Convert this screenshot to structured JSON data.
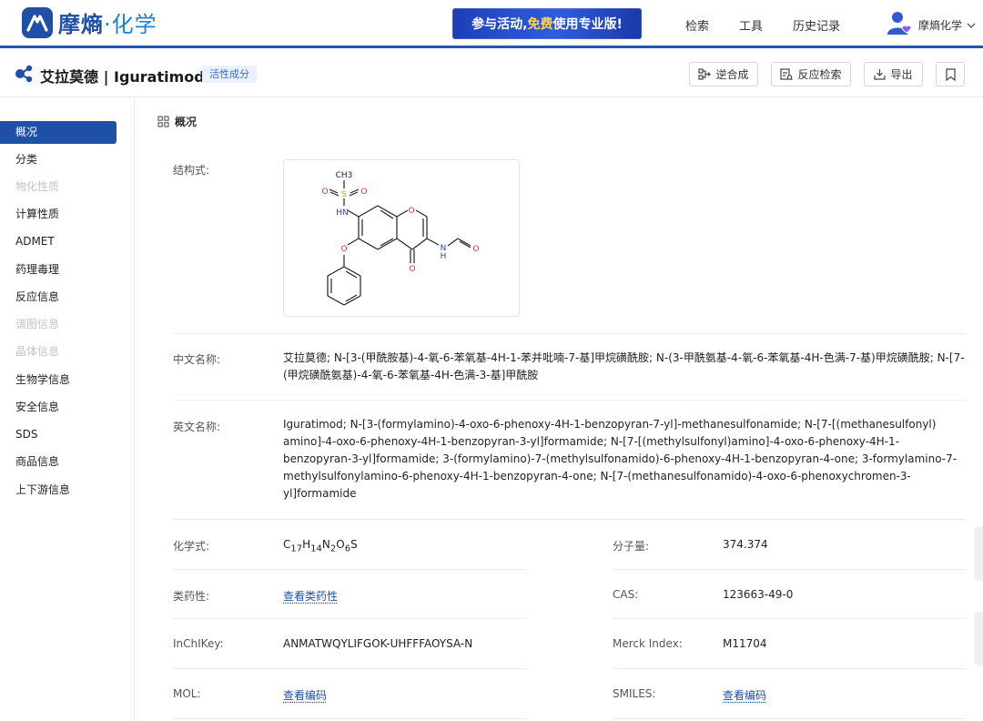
{
  "brand": {
    "name_main": "摩熵",
    "name_dot": "·",
    "name_accent": "化学"
  },
  "promo": {
    "pre": "参与活动,",
    "highlight": "免费",
    "post": "使用专业版!"
  },
  "nav": {
    "search": "检索",
    "tools": "工具",
    "history": "历史记录"
  },
  "user": {
    "name": "摩熵化学"
  },
  "compound": {
    "title": "艾拉莫德 | Iguratimod",
    "tag": "活性成分"
  },
  "toolbar": {
    "retro": "逆合成",
    "reaction_search": "反应检索",
    "export": "导出"
  },
  "sidebar": {
    "items": [
      {
        "label": "概况",
        "state": "active"
      },
      {
        "label": "分类",
        "state": "normal"
      },
      {
        "label": "物化性质",
        "state": "disabled"
      },
      {
        "label": "计算性质",
        "state": "normal"
      },
      {
        "label": "ADMET",
        "state": "normal"
      },
      {
        "label": "药理毒理",
        "state": "normal"
      },
      {
        "label": "反应信息",
        "state": "normal"
      },
      {
        "label": "谱图信息",
        "state": "disabled"
      },
      {
        "label": "晶体信息",
        "state": "disabled"
      },
      {
        "label": "生物学信息",
        "state": "normal"
      },
      {
        "label": "安全信息",
        "state": "normal"
      },
      {
        "label": "SDS",
        "state": "normal"
      },
      {
        "label": "商品信息",
        "state": "normal"
      },
      {
        "label": "上下游信息",
        "state": "normal"
      }
    ]
  },
  "overview": {
    "heading": "概况",
    "structure_label": "结构式:",
    "structure_atoms": {
      "ch3": "CH3",
      "s": "S",
      "o1": "O",
      "o2": "O",
      "nh1": "HN",
      "o_ring": "O",
      "o_ether": "O",
      "o_keto": "O",
      "nh2": "H",
      "n2": "N",
      "o_ald": "O"
    },
    "cn_name_label": "中文名称:",
    "cn_name": "艾拉莫德; N-[3-(甲酰胺基)-4-氧-6-苯氧基-4H-1-苯并吡喃-7-基]甲烷磺酰胺; N-(3-甲酰氨基-4-氧-6-苯氧基-4H-色满-7-基)甲烷磺酰胺; N-[7-(甲烷磺酰氨基)-4-氧-6-苯氧基-4H-色满-3-基]甲酰胺",
    "en_name_label": "英文名称:",
    "en_name": "Iguratimod; N-[3-(formylamino)-4-oxo-6-phenoxy-4H-1-benzopyran-7-yl]-methanesulfonamide; N-[7-[(methanesulfonyl) amino]-4-oxo-6-phenoxy-4H-1-benzopyran-3-yl]formamide; N-[7-[(methylsulfonyl)amino]-4-oxo-6-phenoxy-4H-1-benzopyran-3-yl]formamide; 3-(formylamino)-7-(methylsulfonamido)-6-phenoxy-4H-1-benzopyran-4-one; 3-formylamino-7-methylsulfonylamino-6-phenoxy-4H-1-benzopyran-4-one; N-[7-(methanesulfonamido)-4-oxo-6-phenoxychromen-3-yl]formamide",
    "formula_label": "化学式:",
    "formula": {
      "c": "C",
      "c_n": "17",
      "h": "H",
      "h_n": "14",
      "n": "N",
      "n_n": "2",
      "o": "O",
      "o_n": "6",
      "s": "S"
    },
    "mw_label": "分子量:",
    "mw": "374.374",
    "druglike_label": "类药性:",
    "druglike_link": "查看类药性",
    "cas_label": "CAS:",
    "cas": "123663-49-0",
    "inchikey_label": "InChIKey:",
    "inchikey": "ANMATWQYLIFGOK-UHFFFAOYSA-N",
    "merck_label": "Merck Index:",
    "merck": "M11704",
    "mol_label": "MOL:",
    "mol_link": "查看编码",
    "smiles_label": "SMILES:",
    "smiles_link": "查看编码"
  },
  "colors": {
    "brand_blue": "#1f4fa6",
    "link_blue": "#1f4fa6",
    "heteroatom_red": "#e0302a",
    "heteroatom_blue": "#2b3fd1"
  }
}
